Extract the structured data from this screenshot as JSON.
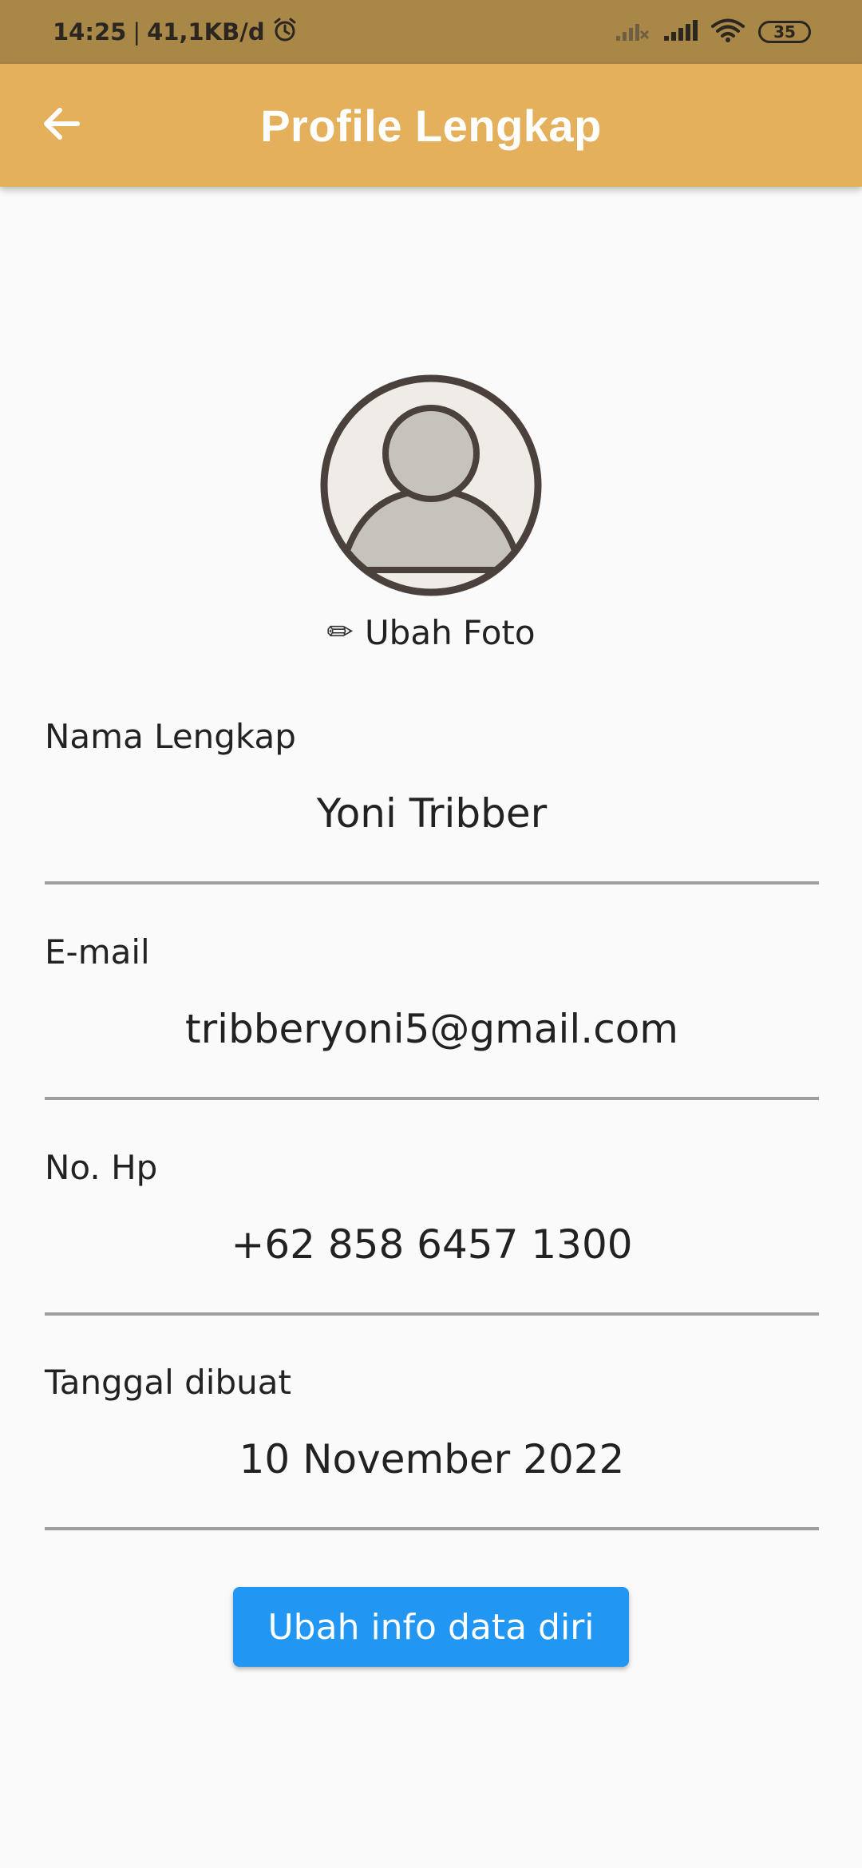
{
  "status_bar": {
    "time": "14:25",
    "separator": "|",
    "data_rate": "41,1KB/d",
    "battery_level": "35"
  },
  "app_bar": {
    "title": "Profile Lengkap",
    "back_icon": "arrow-left-icon",
    "background_color": "#e5b05c"
  },
  "profile": {
    "avatar_icon": "user-avatar-icon",
    "change_photo_icon": "pencil-icon",
    "change_photo_label": "Ubah Foto"
  },
  "fields": [
    {
      "label": "Nama Lengkap",
      "value": "Yoni Tribber"
    },
    {
      "label": "E-mail",
      "value": "tribberyoni5@gmail.com"
    },
    {
      "label": "No. Hp",
      "value": "+62 858 6457 1300"
    },
    {
      "label": "Tanggal dibuat",
      "value": "10 November 2022"
    }
  ],
  "actions": {
    "edit_info_label": "Ubah info data diri",
    "edit_info_color": "#2196f3"
  }
}
